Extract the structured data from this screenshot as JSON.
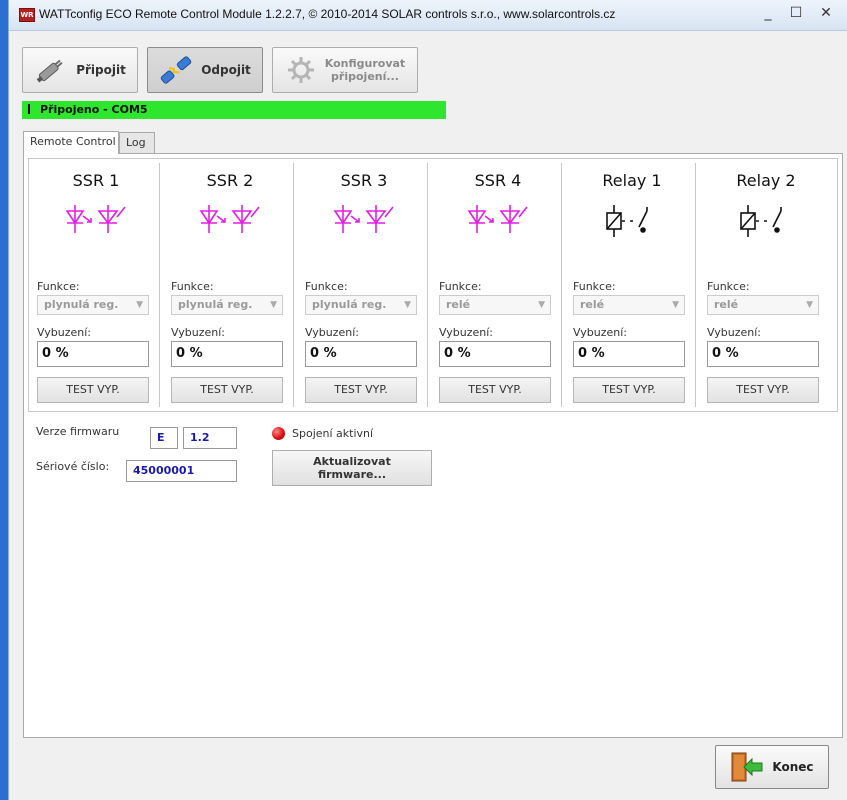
{
  "window": {
    "app_icon_text": "WR",
    "title": "WATTconfig ECO Remote Control Module 1.2.2.7, © 2010-2014 SOLAR controls s.r.o., www.solarcontrols.cz",
    "minimize_glyph": "_",
    "maximize_glyph": "☐",
    "close_glyph": "✕"
  },
  "toolbar": {
    "connect_label": "Připojit",
    "disconnect_label": "Odpojit",
    "configure_label_line1": "Konfigurovat",
    "configure_label_line2": "připojení..."
  },
  "status": {
    "text": "Připojeno - COM5",
    "color": "#2ee62e"
  },
  "tabs": [
    {
      "label": "Remote Control",
      "active": true
    },
    {
      "label": "Log",
      "active": false
    }
  ],
  "labels": {
    "function": "Funkce:",
    "excitation": "Vybuzení:"
  },
  "channels": [
    {
      "title": "SSR 1",
      "icon": "ssr-icon",
      "function": "plynulá reg.",
      "value": "0 %",
      "button": "TEST VYP."
    },
    {
      "title": "SSR 2",
      "icon": "ssr-icon",
      "function": "plynulá reg.",
      "value": "0 %",
      "button": "TEST VYP."
    },
    {
      "title": "SSR 3",
      "icon": "ssr-icon",
      "function": "plynulá reg.",
      "value": "0 %",
      "button": "TEST VYP."
    },
    {
      "title": "SSR 4",
      "icon": "ssr-icon",
      "function": "relé",
      "value": "0 %",
      "button": "TEST VYP."
    },
    {
      "title": "Relay 1",
      "icon": "relay-icon",
      "function": "relé",
      "value": "0 %",
      "button": "TEST VYP."
    },
    {
      "title": "Relay 2",
      "icon": "relay-icon",
      "function": "relé",
      "value": "0 %",
      "button": "TEST VYP."
    }
  ],
  "firmware": {
    "version_label": "Verze firmwaru",
    "version_prefix": "E",
    "version": "1.2",
    "serial_label": "Sériové číslo:",
    "serial": "45000001",
    "connection_status": "Spojení aktivní",
    "update_line1": "Aktualizovat",
    "update_line2": "firmware..."
  },
  "exit_label": "Konec",
  "colors": {
    "ssr_icon": "#e020e0",
    "led": "#e01010",
    "value_text": "#1a1aa8"
  }
}
